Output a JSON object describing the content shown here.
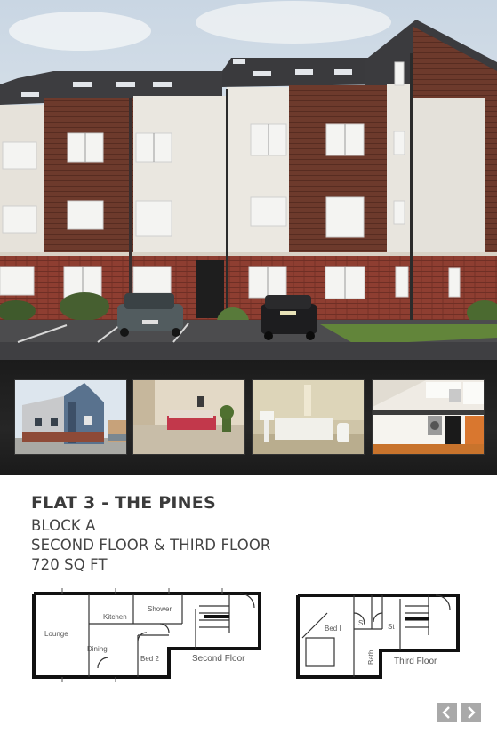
{
  "listing": {
    "title": "FLAT 3 - THE PINES",
    "block": "BLOCK A",
    "floors": "SECOND FLOOR & THIRD FLOOR",
    "area": "720 SQ FT"
  },
  "floorplan_second": {
    "lounge": "Lounge",
    "kitchen": "Kitchen",
    "shower": "Shower",
    "dining": "Dining",
    "bed2": "Bed 2",
    "caption": "Second Floor"
  },
  "floorplan_third": {
    "bed1": "Bed l",
    "st1": "St",
    "st2": "St",
    "bath": "Bath",
    "caption": "Third Floor"
  },
  "nav": {
    "prev_icon": "chevron-left-icon",
    "next_icon": "chevron-right-icon"
  },
  "colors": {
    "brick": "#8a3b2e",
    "cladding": "#6b3a2c",
    "render": "#e9e6df",
    "roof": "#3a3a3c",
    "strip_bg": "#1e1e1e",
    "nav_btn": "#a9a9a9"
  }
}
